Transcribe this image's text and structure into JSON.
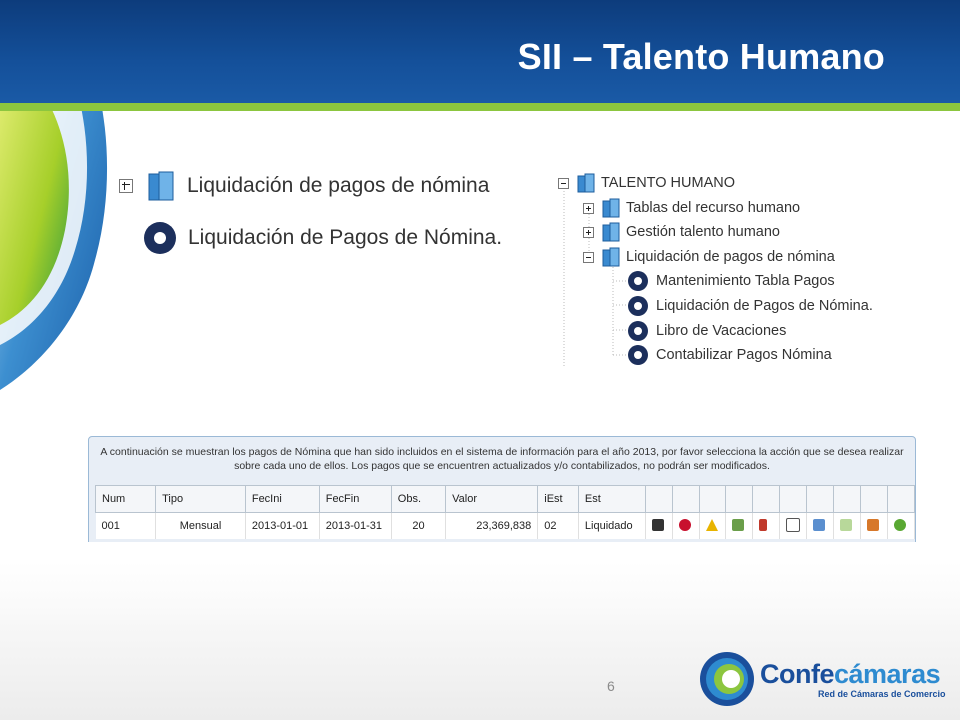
{
  "slide": {
    "title": "SII – Talento Humano",
    "page_number": "6"
  },
  "left_menu": {
    "folder_label": "Liquidación de pagos de nómina",
    "action_label": "Liquidación de Pagos de Nómina."
  },
  "tree": {
    "root": "TALENTO HUMANO",
    "children": [
      {
        "label": "Tablas del recurso humano",
        "expander": "plus"
      },
      {
        "label": "Gestión talento humano",
        "expander": "plus"
      },
      {
        "label": "Liquidación de pagos de nómina",
        "expander": "minus"
      }
    ],
    "actions": [
      "Mantenimiento Tabla Pagos",
      "Liquidación de Pagos de Nómina.",
      "Libro de Vacaciones",
      "Contabilizar Pagos Nómina"
    ]
  },
  "payments": {
    "notice": "A continuación se muestran los pagos de Nómina que han sido incluidos en el sistema de información para el año 2013, por favor selecciona la acción que se desea realizar sobre cada uno de ellos. Los pagos que se encuentren actualizados y/o contabilizados, no podrán ser modificados.",
    "headers": [
      "Num",
      "Tipo",
      "FecIni",
      "FecFin",
      "Obs.",
      "Valor",
      "iEst",
      "Est"
    ],
    "rows": [
      {
        "num": "001",
        "tipo": "Mensual",
        "fecini": "2013-01-01",
        "fecfin": "2013-01-31",
        "obs": "20",
        "valor": "23,369,838",
        "iest": "02",
        "est": "Liquidado"
      }
    ],
    "action_icons": [
      "print-icon",
      "delete-icon",
      "warning-icon",
      "users-icon",
      "transfer-icon",
      "list-icon",
      "send-icon",
      "edit-icon",
      "calendar-icon",
      "refresh-icon"
    ]
  },
  "logo": {
    "brand_part1": "Confe",
    "brand_part2": "cámaras",
    "tagline": "Red de Cámaras de Comercio"
  },
  "colors": {
    "header_blue": "#14509a",
    "header_line_green": "#8cc63f",
    "gear_navy": "#1c2f5c",
    "brand_blue": "#1a4f9c"
  }
}
